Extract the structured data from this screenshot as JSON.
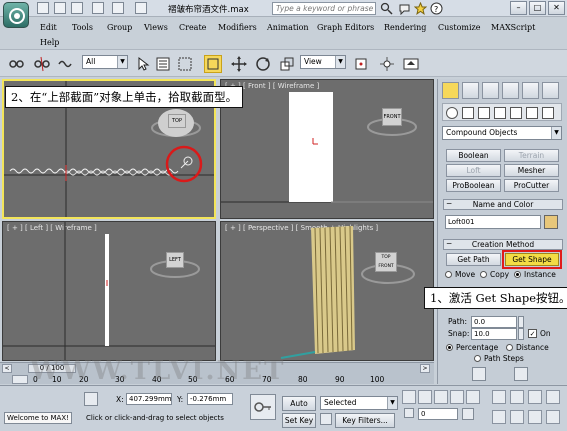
{
  "title_bar": {
    "document_title": "褶皱布帘酒文件.max",
    "search_placeholder": "Type a keyword or phrase"
  },
  "menu": {
    "items": [
      "Edit",
      "Tools",
      "Group",
      "Views",
      "Create",
      "Modifiers",
      "Animation",
      "Graph Editors",
      "Rendering",
      "Customize",
      "MAXScript",
      "Help"
    ]
  },
  "toolbar": {
    "selection_filter": "All",
    "reference_coord": "View"
  },
  "viewports": {
    "top": {
      "label": "",
      "cube_label": "TOP"
    },
    "front": {
      "label": "[ + ] [ Front ] [ Wireframe ]",
      "cube_label": "FRONT"
    },
    "left": {
      "label": "[ + ] [ Left ] [ Wireframe ]",
      "cube_label": "LEFT"
    },
    "perspective": {
      "label": "[ + ] [ Perspective ] [ Smooth + Highlights ]",
      "cube_label": "TOP FRONT"
    }
  },
  "callouts": {
    "top": "2、在“上部截面”对象上单击，拾取截面型。",
    "right": "1、激活 Get Shape按钮。"
  },
  "command_panel": {
    "category_dropdown": "Compound Objects",
    "object_buttons": [
      "Boolean",
      "Terrain",
      "Loft",
      "Mesher",
      "ProBoolean",
      "ProCutter"
    ],
    "name_color_header": "Name and Color",
    "object_name": "Loft001",
    "object_color": "#e8c77a",
    "creation_method_header": "Creation Method",
    "get_path_label": "Get Path",
    "get_shape_label": "Get Shape",
    "get_shape_active_color": "#f3dc45",
    "highlight_color": "#e01b1b",
    "radio_move": "Move",
    "radio_copy": "Copy",
    "radio_instance": "Instance",
    "path_label": "Path:",
    "path_value": "0.0",
    "snap_label": "Snap:",
    "snap_value": "10.0",
    "on_label": "On",
    "percentage_label": "Percentage",
    "distance_label": "Distance",
    "path_steps_label": "Path Steps"
  },
  "timeline": {
    "frame_display": "0 / 100",
    "ticks": [
      "0",
      "10",
      "20",
      "30",
      "40",
      "50",
      "60",
      "70",
      "80",
      "90",
      "100"
    ]
  },
  "status_bar": {
    "script_text": "Welcome to MAX!",
    "prompt": "Click or click-and-drag to select objects",
    "x_label": "X:",
    "x_value": "407.299mm",
    "y_label": "Y:",
    "y_value": "-0.276mm",
    "auto_key": "Auto Key",
    "set_key": "Set Key",
    "key_mode": "Selected",
    "key_filters": "Key Filters...",
    "frame_value": "0"
  },
  "watermark": "WWW.TLVI.NET"
}
